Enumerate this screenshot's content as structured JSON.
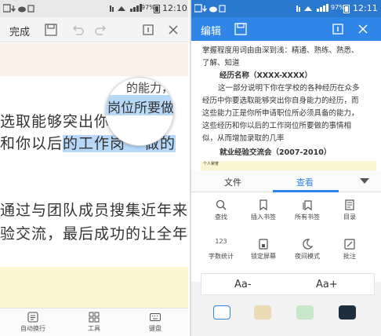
{
  "left": {
    "status_time": "12:10",
    "status_battery": "97%",
    "toolbar": {
      "done_label": "完成"
    },
    "body_lines": {
      "line1_a": "选取能够突出你",
      "line1_b": "经",
      "line2_a": "和你以后",
      "line2_b": "的工作岗",
      "line2_c": "做的",
      "line3": "通过与团队成员搜集近年来专",
      "line4": "验交流，最后成功的让全年级"
    },
    "magnifier": {
      "top_text": "的能力，",
      "line_text": "岗位所要做"
    },
    "bottom_bar": [
      {
        "label": "自动换行",
        "icon": "wrap-icon"
      },
      {
        "label": "工具",
        "icon": "tools-grid-icon"
      },
      {
        "label": "键盘",
        "icon": "keyboard-icon"
      }
    ]
  },
  "right": {
    "status_time": "12:11",
    "status_battery": "97%",
    "toolbar": {
      "edit_label": "编辑"
    },
    "doc_lines": [
      "掌握程度用词由由深到浅：精通、熟练、熟悉、",
      "了解、知道",
      "经历名称（XXXX-XXXX）",
      "这一部分说明下你在学校的各种经历在众多",
      "经历中你要选取能够突出你自身能力的经历，而",
      "这些能力正是你所申请职位所必须具备的能力，",
      "这些经历和你以后的工作岗位所要做的事情相",
      "似，从而增加录取的几率",
      "就业经验交流会（2007-2010）"
    ],
    "preview_text": "个人荣誉",
    "tabs": [
      {
        "label": "文件"
      },
      {
        "label": "查看"
      }
    ],
    "active_tab": "查看",
    "grid_items": [
      {
        "label": "查找",
        "icon": "search-icon"
      },
      {
        "label": "插入书签",
        "icon": "bookmark-icon"
      },
      {
        "label": "所有书签",
        "icon": "all-bookmarks-icon"
      },
      {
        "label": "目录",
        "icon": "contents-icon"
      },
      {
        "label": "字数统计",
        "icon": "word-count-icon"
      },
      {
        "label": "锁定屏幕",
        "icon": "lock-screen-icon"
      },
      {
        "label": "夜间模式",
        "icon": "night-mode-icon"
      },
      {
        "label": "批注",
        "icon": "comment-icon"
      }
    ],
    "word_count_glyph": "123",
    "font_controls": {
      "decrease": "Aa-",
      "increase": "Aa+"
    },
    "bg_colors": [
      "#ffffff",
      "#eadbb4",
      "#c8e6c9",
      "#1e2e3e"
    ],
    "accent": "#2f86e6"
  }
}
